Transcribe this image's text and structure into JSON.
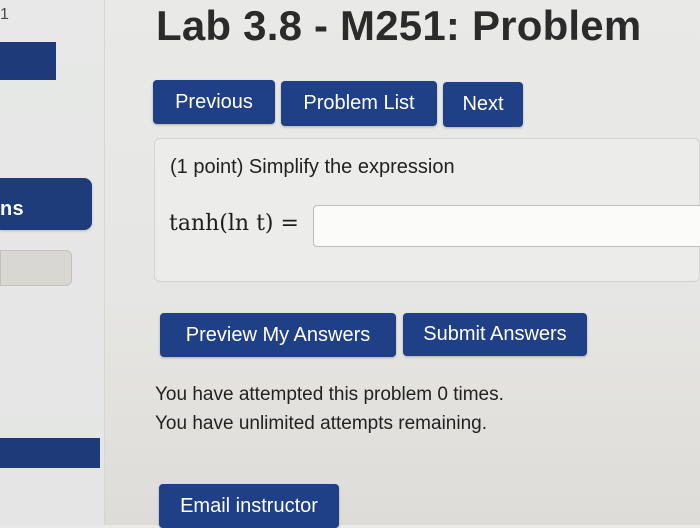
{
  "sidebar": {
    "top_fragment": "1",
    "panel_label": "ns"
  },
  "header": {
    "title": "Lab 3.8 - M251: Problem"
  },
  "nav": {
    "previous": "Previous",
    "problem_list": "Problem List",
    "next": "Next"
  },
  "problem": {
    "prompt": "(1 point) Simplify the expression",
    "expression": "tanh(ln t) =",
    "answer_value": ""
  },
  "actions": {
    "preview": "Preview My Answers",
    "submit": "Submit Answers"
  },
  "status": {
    "attempts_line": "You have attempted this problem 0 times.",
    "remaining_line": "You have unlimited attempts remaining."
  },
  "footer": {
    "email": "Email instructor"
  },
  "colors": {
    "button_bg": "#1f3f86",
    "page_bg": "#e7e7e5"
  }
}
